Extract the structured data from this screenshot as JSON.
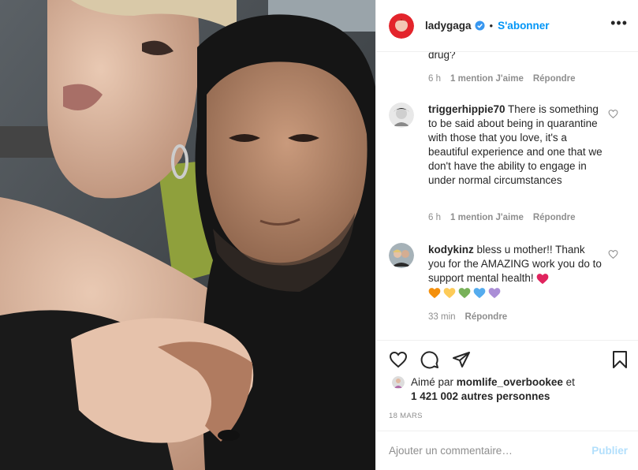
{
  "post": {
    "username": "ladygaga",
    "follow_label": "S'abonner",
    "more_label": "•••",
    "date": "18 MARS"
  },
  "comments": {
    "fragment_text": "drug?",
    "fragment_meta": {
      "time": "6 h",
      "likes": "1 mention J'aime",
      "reply": "Répondre"
    },
    "items": [
      {
        "username": "triggerhippie70",
        "text": "There is something to be said about being in quarantine with those that you love, it's a beautiful experience and one that we don't have the ability to engage in under normal circumstances",
        "time": "6 h",
        "likes": "1 mention J'aime",
        "reply": "Répondre"
      },
      {
        "username": "kodykinz",
        "text": "bless u mother!! Thank you for the AMAZING work you do to support mental health!",
        "time": "33 min",
        "reply": "Répondre",
        "heart_colors": [
          "#e0245e",
          "#f4900c",
          "#fdcb58",
          "#78b159",
          "#55acee",
          "#aa8ed6"
        ]
      }
    ]
  },
  "likes": {
    "prefix": "Aimé par",
    "user": "momlife_overbookee",
    "conj": "et",
    "others": "1 421 002 autres personnes"
  },
  "composer": {
    "placeholder": "Ajouter un commentaire…",
    "post_label": "Publier"
  },
  "colors": {
    "accent": "#0095f6",
    "muted": "#8e8e8e",
    "text": "#262626",
    "publish_disabled": "#b2dffc"
  },
  "icons": [
    "verified-badge-icon",
    "heart-icon",
    "comment-icon",
    "share-icon",
    "bookmark-icon",
    "small-heart-icon"
  ]
}
